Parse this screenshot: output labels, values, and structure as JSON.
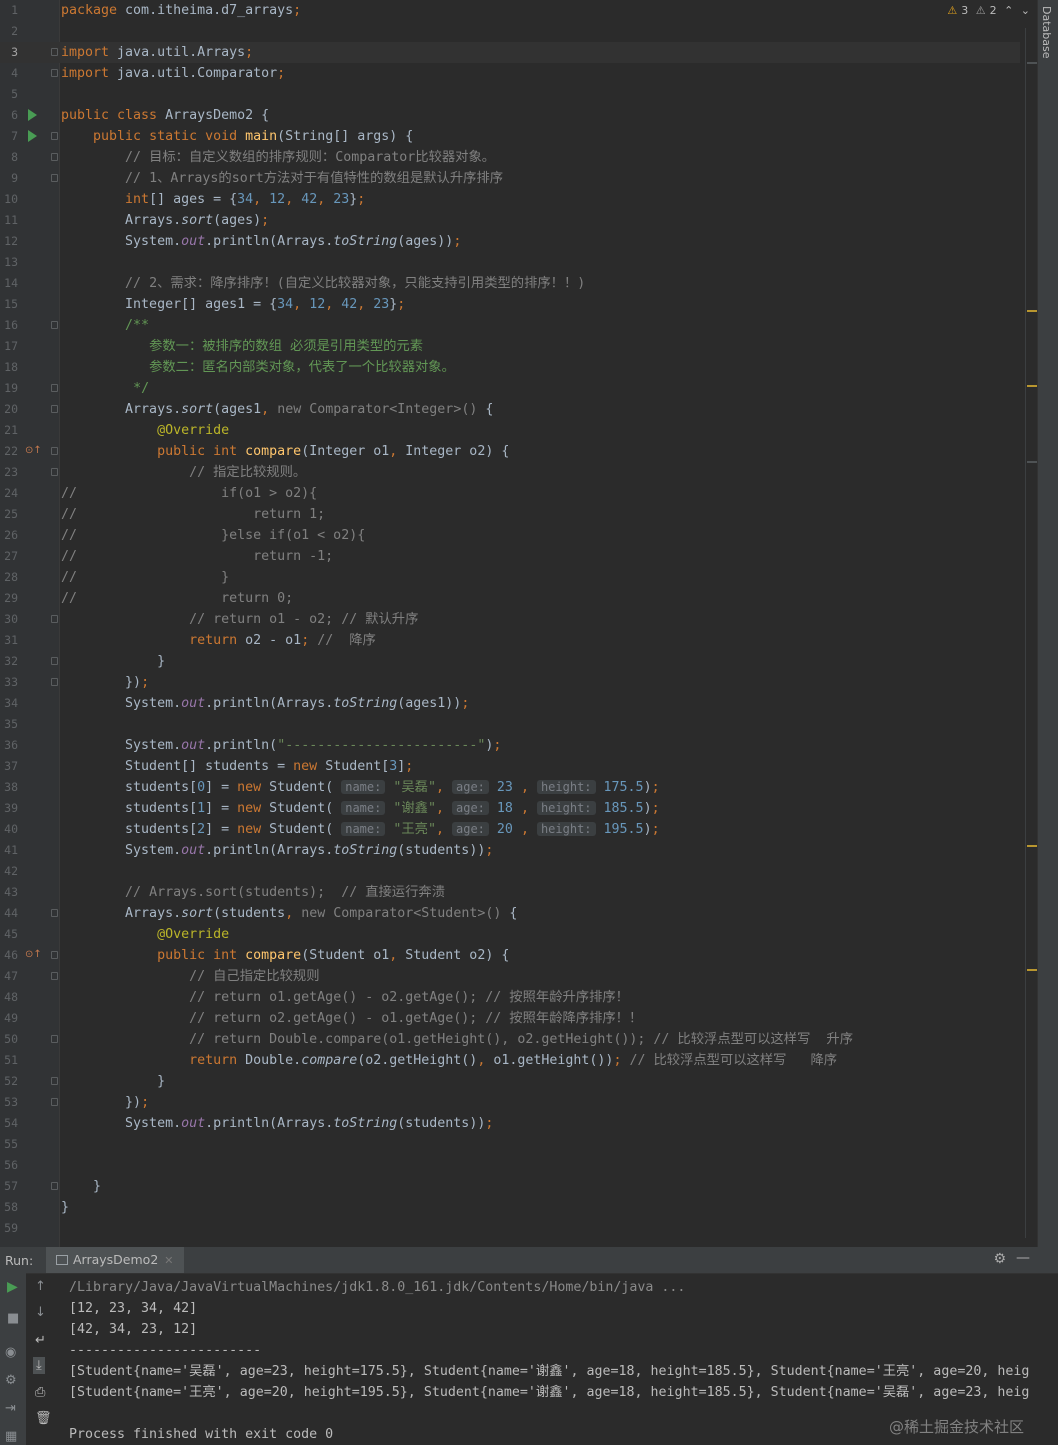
{
  "editor": {
    "file_tab": "ArraysDemo2",
    "inspections": {
      "warnings": "3",
      "weak_warnings": "2"
    },
    "lines": [
      {
        "n": "1",
        "tokens": [
          [
            "kw",
            "package "
          ],
          [
            "",
            "com.itheima.d7_arrays"
          ],
          [
            "kw",
            ";"
          ]
        ]
      },
      {
        "n": "2",
        "tokens": []
      },
      {
        "n": "3",
        "current": true,
        "fold": true,
        "tokens": [
          [
            "kw",
            "import "
          ],
          [
            "",
            "java.util.Arrays"
          ],
          [
            "kw",
            ";"
          ]
        ]
      },
      {
        "n": "4",
        "fold": true,
        "tokens": [
          [
            "kw",
            "import "
          ],
          [
            "",
            "java.util.Comparator"
          ],
          [
            "kw",
            ";"
          ]
        ]
      },
      {
        "n": "5",
        "tokens": []
      },
      {
        "n": "6",
        "run": true,
        "tokens": [
          [
            "kw",
            "public class "
          ],
          [
            "",
            "ArraysDemo2 {"
          ]
        ]
      },
      {
        "n": "7",
        "run": true,
        "fold": true,
        "tokens": [
          [
            "",
            "    "
          ],
          [
            "kw",
            "public static void "
          ],
          [
            "fn",
            "main"
          ],
          [
            "",
            "(String[] args) {"
          ]
        ]
      },
      {
        "n": "8",
        "fold": true,
        "tokens": [
          [
            "",
            "        "
          ],
          [
            "cm",
            "// 目标：自定义数组的排序规则：Comparator比较器对象。"
          ]
        ]
      },
      {
        "n": "9",
        "fold": true,
        "tokens": [
          [
            "",
            "        "
          ],
          [
            "cm",
            "// 1、Arrays的sort方法对于有值特性的数组是默认升序排序"
          ]
        ]
      },
      {
        "n": "10",
        "tokens": [
          [
            "",
            "        "
          ],
          [
            "kw",
            "int"
          ],
          [
            "",
            "[] ages = {"
          ],
          [
            "num",
            "34"
          ],
          [
            "kw",
            ", "
          ],
          [
            "num",
            "12"
          ],
          [
            "kw",
            ", "
          ],
          [
            "num",
            "42"
          ],
          [
            "kw",
            ", "
          ],
          [
            "num",
            "23"
          ],
          [
            "",
            "}"
          ],
          [
            "kw",
            ";"
          ]
        ]
      },
      {
        "n": "11",
        "tokens": [
          [
            "",
            "        Arrays."
          ],
          [
            "it",
            "sort"
          ],
          [
            "",
            "(ages)"
          ],
          [
            "kw",
            ";"
          ]
        ]
      },
      {
        "n": "12",
        "tokens": [
          [
            "",
            "        System."
          ],
          [
            "fld",
            "out"
          ],
          [
            "",
            ".println(Arrays."
          ],
          [
            "it",
            "toString"
          ],
          [
            "",
            "(ages))"
          ],
          [
            "kw",
            ";"
          ]
        ]
      },
      {
        "n": "13",
        "tokens": []
      },
      {
        "n": "14",
        "tokens": [
          [
            "",
            "        "
          ],
          [
            "cm",
            "// 2、需求：降序排序！(自定义比较器对象，只能支持引用类型的排序！！)"
          ]
        ]
      },
      {
        "n": "15",
        "tokens": [
          [
            "",
            "        Integer[] ages1 = {"
          ],
          [
            "num",
            "34"
          ],
          [
            "kw",
            ", "
          ],
          [
            "num",
            "12"
          ],
          [
            "kw",
            ", "
          ],
          [
            "num",
            "42"
          ],
          [
            "kw",
            ", "
          ],
          [
            "num",
            "23"
          ],
          [
            "",
            "}"
          ],
          [
            "kw",
            ";"
          ]
        ]
      },
      {
        "n": "16",
        "fold": true,
        "tokens": [
          [
            "",
            "        "
          ],
          [
            "cmz",
            "/**"
          ]
        ]
      },
      {
        "n": "17",
        "tokens": [
          [
            "",
            "           "
          ],
          [
            "cmz",
            "参数一：被排序的数组 必须是引用类型的元素"
          ]
        ]
      },
      {
        "n": "18",
        "tokens": [
          [
            "",
            "           "
          ],
          [
            "cmz",
            "参数二：匿名内部类对象，代表了一个比较器对象。"
          ]
        ]
      },
      {
        "n": "19",
        "fold": true,
        "tokens": [
          [
            "",
            "         "
          ],
          [
            "cmz",
            "*/"
          ]
        ]
      },
      {
        "n": "20",
        "fold": true,
        "tokens": [
          [
            "",
            "        Arrays."
          ],
          [
            "it",
            "sort"
          ],
          [
            "",
            "(ages1"
          ],
          [
            "kw",
            ", "
          ],
          [
            "cm",
            "new "
          ],
          [
            "cm",
            "Comparator<Integer>() "
          ],
          [
            "",
            "{"
          ]
        ]
      },
      {
        "n": "21",
        "tokens": [
          [
            "",
            "            "
          ],
          [
            "an",
            "@Override"
          ]
        ]
      },
      {
        "n": "22",
        "override": true,
        "fold": true,
        "tokens": [
          [
            "",
            "            "
          ],
          [
            "kw",
            "public int "
          ],
          [
            "fn",
            "compare"
          ],
          [
            "",
            "(Integer o1"
          ],
          [
            "kw",
            ", "
          ],
          [
            "",
            "Integer o2) {"
          ]
        ]
      },
      {
        "n": "23",
        "fold": true,
        "tokens": [
          [
            "",
            "                "
          ],
          [
            "cm",
            "// 指定比较规则。"
          ]
        ]
      },
      {
        "n": "24",
        "tokens": [
          [
            "cm",
            "//                  if(o1 > o2){"
          ]
        ]
      },
      {
        "n": "25",
        "tokens": [
          [
            "cm",
            "//                      return 1;"
          ]
        ]
      },
      {
        "n": "26",
        "tokens": [
          [
            "cm",
            "//                  }else if(o1 < o2){"
          ]
        ]
      },
      {
        "n": "27",
        "tokens": [
          [
            "cm",
            "//                      return -1;"
          ]
        ]
      },
      {
        "n": "28",
        "tokens": [
          [
            "cm",
            "//                  }"
          ]
        ]
      },
      {
        "n": "29",
        "tokens": [
          [
            "cm",
            "//                  return 0;"
          ]
        ]
      },
      {
        "n": "30",
        "fold": true,
        "tokens": [
          [
            "",
            "                "
          ],
          [
            "cm",
            "// return o1 - o2; // 默认升序"
          ]
        ]
      },
      {
        "n": "31",
        "tokens": [
          [
            "",
            "                "
          ],
          [
            "kw",
            "return "
          ],
          [
            "",
            "o2 - o1"
          ],
          [
            "kw",
            "; "
          ],
          [
            "cm",
            "//  降序"
          ]
        ]
      },
      {
        "n": "32",
        "fold": true,
        "tokens": [
          [
            "",
            "            }"
          ]
        ]
      },
      {
        "n": "33",
        "fold": true,
        "tokens": [
          [
            "",
            "        })"
          ],
          [
            "kw",
            ";"
          ]
        ]
      },
      {
        "n": "34",
        "tokens": [
          [
            "",
            "        System."
          ],
          [
            "fld",
            "out"
          ],
          [
            "",
            ".println(Arrays."
          ],
          [
            "it",
            "toString"
          ],
          [
            "",
            "(ages1))"
          ],
          [
            "kw",
            ";"
          ]
        ]
      },
      {
        "n": "35",
        "tokens": []
      },
      {
        "n": "36",
        "tokens": [
          [
            "",
            "        System."
          ],
          [
            "fld",
            "out"
          ],
          [
            "",
            ".println("
          ],
          [
            "str",
            "\"------------------------\""
          ],
          [
            "",
            ")"
          ],
          [
            "kw",
            ";"
          ]
        ]
      },
      {
        "n": "37",
        "tokens": [
          [
            "",
            "        Student[] students = "
          ],
          [
            "kw",
            "new "
          ],
          [
            "",
            "Student["
          ],
          [
            "num",
            "3"
          ],
          [
            "",
            "]"
          ],
          [
            "kw",
            ";"
          ]
        ]
      },
      {
        "n": "38",
        "tokens": [
          [
            "",
            "        students["
          ],
          [
            "num",
            "0"
          ],
          [
            "",
            "] = "
          ],
          [
            "kw",
            "new "
          ],
          [
            "",
            "Student( "
          ],
          [
            "hint",
            "name:"
          ],
          [
            "str",
            " \"吴磊\""
          ],
          [
            "kw",
            ", "
          ],
          [
            "hint",
            "age:"
          ],
          [
            "num",
            " 23 "
          ],
          [
            "kw",
            ", "
          ],
          [
            "hint",
            "height:"
          ],
          [
            "num",
            " 175.5"
          ],
          [
            "",
            ")"
          ],
          [
            "kw",
            ";"
          ]
        ]
      },
      {
        "n": "39",
        "tokens": [
          [
            "",
            "        students["
          ],
          [
            "num",
            "1"
          ],
          [
            "",
            "] = "
          ],
          [
            "kw",
            "new "
          ],
          [
            "",
            "Student( "
          ],
          [
            "hint",
            "name:"
          ],
          [
            "str",
            " \"谢鑫\""
          ],
          [
            "kw",
            ", "
          ],
          [
            "hint",
            "age:"
          ],
          [
            "num",
            " 18 "
          ],
          [
            "kw",
            ", "
          ],
          [
            "hint",
            "height:"
          ],
          [
            "num",
            " 185.5"
          ],
          [
            "",
            ")"
          ],
          [
            "kw",
            ";"
          ]
        ]
      },
      {
        "n": "40",
        "tokens": [
          [
            "",
            "        students["
          ],
          [
            "num",
            "2"
          ],
          [
            "",
            "] = "
          ],
          [
            "kw",
            "new "
          ],
          [
            "",
            "Student( "
          ],
          [
            "hint",
            "name:"
          ],
          [
            "str",
            " \"王亮\""
          ],
          [
            "kw",
            ", "
          ],
          [
            "hint",
            "age:"
          ],
          [
            "num",
            " 20 "
          ],
          [
            "kw",
            ", "
          ],
          [
            "hint",
            "height:"
          ],
          [
            "num",
            " 195.5"
          ],
          [
            "",
            ")"
          ],
          [
            "kw",
            ";"
          ]
        ]
      },
      {
        "n": "41",
        "tokens": [
          [
            "",
            "        System."
          ],
          [
            "fld",
            "out"
          ],
          [
            "",
            ".println(Arrays."
          ],
          [
            "it",
            "toString"
          ],
          [
            "",
            "(students))"
          ],
          [
            "kw",
            ";"
          ]
        ]
      },
      {
        "n": "42",
        "tokens": []
      },
      {
        "n": "43",
        "tokens": [
          [
            "",
            "        "
          ],
          [
            "cm",
            "// Arrays.sort(students);  // 直接运行奔溃"
          ]
        ]
      },
      {
        "n": "44",
        "fold": true,
        "tokens": [
          [
            "",
            "        Arrays."
          ],
          [
            "it",
            "sort"
          ],
          [
            "",
            "(students"
          ],
          [
            "kw",
            ", "
          ],
          [
            "cm",
            "new "
          ],
          [
            "cm",
            "Comparator<Student>() "
          ],
          [
            "",
            "{"
          ]
        ]
      },
      {
        "n": "45",
        "tokens": [
          [
            "",
            "            "
          ],
          [
            "an",
            "@Override"
          ]
        ]
      },
      {
        "n": "46",
        "override": true,
        "fold": true,
        "tokens": [
          [
            "",
            "            "
          ],
          [
            "kw",
            "public int "
          ],
          [
            "fn",
            "compare"
          ],
          [
            "",
            "(Student o1"
          ],
          [
            "kw",
            ", "
          ],
          [
            "",
            "Student o2) {"
          ]
        ]
      },
      {
        "n": "47",
        "fold": true,
        "tokens": [
          [
            "",
            "                "
          ],
          [
            "cm",
            "// 自己指定比较规则"
          ]
        ]
      },
      {
        "n": "48",
        "tokens": [
          [
            "",
            "                "
          ],
          [
            "cm",
            "// return o1.getAge() - o2.getAge(); // 按照年龄升序排序！"
          ]
        ]
      },
      {
        "n": "49",
        "tokens": [
          [
            "",
            "                "
          ],
          [
            "cm",
            "// return o2.getAge() - o1.getAge(); // 按照年龄降序排序！！"
          ]
        ]
      },
      {
        "n": "50",
        "fold": true,
        "tokens": [
          [
            "",
            "                "
          ],
          [
            "cm",
            "// return Double.compare(o1.getHeight(), o2.getHeight()); // 比较浮点型可以这样写  升序"
          ]
        ]
      },
      {
        "n": "51",
        "tokens": [
          [
            "",
            "                "
          ],
          [
            "kw",
            "return "
          ],
          [
            "",
            "Double."
          ],
          [
            "it",
            "compare"
          ],
          [
            "",
            "(o2.getHeight()"
          ],
          [
            "kw",
            ", "
          ],
          [
            "",
            "o1.getHeight())"
          ],
          [
            "kw",
            "; "
          ],
          [
            "cm",
            "// 比较浮点型可以这样写   降序"
          ]
        ]
      },
      {
        "n": "52",
        "fold": true,
        "tokens": [
          [
            "",
            "            }"
          ]
        ]
      },
      {
        "n": "53",
        "fold": true,
        "tokens": [
          [
            "",
            "        })"
          ],
          [
            "kw",
            ";"
          ]
        ]
      },
      {
        "n": "54",
        "tokens": [
          [
            "",
            "        System."
          ],
          [
            "fld",
            "out"
          ],
          [
            "",
            ".println(Arrays."
          ],
          [
            "it",
            "toString"
          ],
          [
            "",
            "(students))"
          ],
          [
            "kw",
            ";"
          ]
        ]
      },
      {
        "n": "55",
        "tokens": []
      },
      {
        "n": "56",
        "tokens": []
      },
      {
        "n": "57",
        "fold": true,
        "tokens": [
          [
            "",
            "    }"
          ]
        ]
      },
      {
        "n": "58",
        "tokens": [
          [
            "",
            "}"
          ]
        ]
      },
      {
        "n": "59",
        "tokens": []
      }
    ]
  },
  "sidebar_right": {
    "database_label": "Database"
  },
  "run_panel": {
    "label": "Run:",
    "tab": "ArraysDemo2",
    "output": [
      {
        "cls": "path",
        "text": "/Library/Java/JavaVirtualMachines/jdk1.8.0_161.jdk/Contents/Home/bin/java ..."
      },
      {
        "cls": "",
        "text": "[12, 23, 34, 42]"
      },
      {
        "cls": "",
        "text": "[42, 34, 23, 12]"
      },
      {
        "cls": "",
        "text": "------------------------"
      },
      {
        "cls": "",
        "text": "[Student{name='吴磊', age=23, height=175.5}, Student{name='谢鑫', age=18, height=185.5}, Student{name='王亮', age=20, heig"
      },
      {
        "cls": "",
        "text": "[Student{name='王亮', age=20, height=195.5}, Student{name='谢鑫', age=18, height=185.5}, Student{name='吴磊', age=23, heig"
      },
      {
        "cls": "",
        "text": ""
      },
      {
        "cls": "",
        "text": "Process finished with exit code 0"
      }
    ]
  },
  "watermark": "@稀土掘金技术社区",
  "colors": {
    "background": "#2b2b2b",
    "keyword": "#cc7832",
    "string": "#6a8759",
    "number": "#6897bb",
    "method": "#ffc66d",
    "comment": "#808080",
    "annotation": "#bbb529"
  }
}
